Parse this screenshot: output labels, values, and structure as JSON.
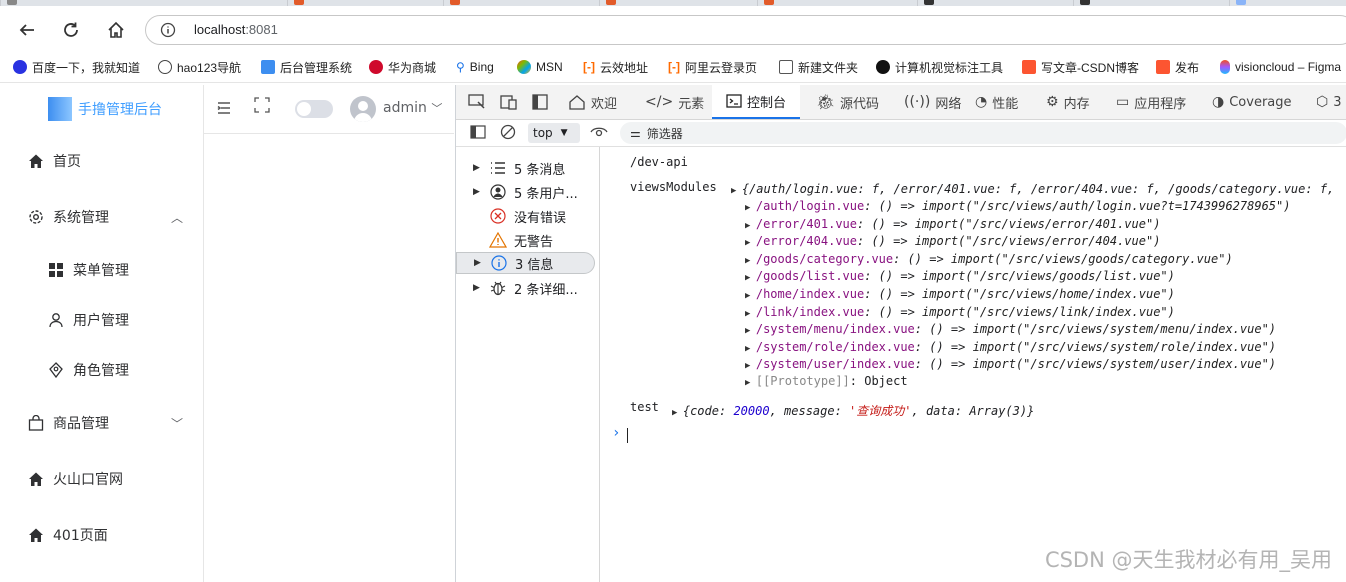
{
  "browser": {
    "url_host": "localhost",
    "url_port": ":8081",
    "bookmarks": [
      {
        "label": "百度一下，我就知道",
        "color": "#2932e1"
      },
      {
        "label": "hao123导航",
        "color": "#444444"
      },
      {
        "label": "后台管理系统",
        "color": "#3d8ef0"
      },
      {
        "label": "华为商城",
        "color": "#cf0a2c"
      },
      {
        "label": "Bing",
        "color": "#1a73e8"
      },
      {
        "label": "MSN",
        "color": "#6b5fd6"
      },
      {
        "label": "云效地址",
        "color": "#ff6a00"
      },
      {
        "label": "阿里云登录页",
        "color": "#ff6a00"
      },
      {
        "label": "新建文件夹",
        "color": "#555555"
      },
      {
        "label": "计算机视觉标注工具",
        "color": "#111111"
      },
      {
        "label": "写文章-CSDN博客",
        "color": "#fc5531"
      },
      {
        "label": "发布",
        "color": "#fc5531"
      },
      {
        "label": "visioncloud – Figma",
        "color": "#a259ff"
      }
    ]
  },
  "app": {
    "logo_text": "手撸管理后台",
    "user": "admin",
    "menu": [
      {
        "label": "首页",
        "icon": "home-icon"
      },
      {
        "label": "系统管理",
        "icon": "gear-icon",
        "arrow": "up"
      },
      {
        "label": "菜单管理",
        "icon": "grid-icon",
        "sub": true
      },
      {
        "label": "用户管理",
        "icon": "user-icon",
        "sub": true
      },
      {
        "label": "角色管理",
        "icon": "role-icon",
        "sub": true
      },
      {
        "label": "商品管理",
        "icon": "bag-icon",
        "arrow": "down"
      },
      {
        "label": "火山口官网",
        "icon": "home-icon"
      },
      {
        "label": "401页面",
        "icon": "home-icon"
      }
    ]
  },
  "devtools": {
    "tabs": [
      "欢迎",
      "元素",
      "控制台",
      "源代码",
      "网络",
      "性能",
      "内存",
      "应用程序",
      "Coverage",
      "3"
    ],
    "active_tab": "控制台",
    "context": "top",
    "filter_placeholder": "筛选器",
    "sidebar": [
      {
        "label": "5 条消息",
        "icon": "list-icon"
      },
      {
        "label": "5 条用户...",
        "icon": "user-circle-icon"
      },
      {
        "label": "没有错误",
        "icon": "error-icon"
      },
      {
        "label": "无警告",
        "icon": "warning-icon"
      },
      {
        "label": "3 信息",
        "icon": "info-icon",
        "selected": true
      },
      {
        "label": "2 条详细...",
        "icon": "bug-icon"
      }
    ],
    "console": {
      "line1": "/dev-api",
      "views_label": "viewsModules",
      "views_summary": "{/auth/login.vue: f, /error/401.vue: f, /error/404.vue: f, /goods/category.vue: f,",
      "entries": [
        {
          "key": "/auth/login.vue",
          "value": "import(\"/src/views/auth/login.vue?t=1743996278965\")"
        },
        {
          "key": "/error/401.vue",
          "value": "import(\"/src/views/error/401.vue\")"
        },
        {
          "key": "/error/404.vue",
          "value": "import(\"/src/views/error/404.vue\")"
        },
        {
          "key": "/goods/category.vue",
          "value": "import(\"/src/views/goods/category.vue\")"
        },
        {
          "key": "/goods/list.vue",
          "value": "import(\"/src/views/goods/list.vue\")"
        },
        {
          "key": "/home/index.vue",
          "value": "import(\"/src/views/home/index.vue\")"
        },
        {
          "key": "/link/index.vue",
          "value": "import(\"/src/views/link/index.vue\")"
        },
        {
          "key": "/system/menu/index.vue",
          "value": "import(\"/src/views/system/menu/index.vue\")"
        },
        {
          "key": "/system/role/index.vue",
          "value": "import(\"/src/views/system/role/index.vue\")"
        },
        {
          "key": "/system/user/index.vue",
          "value": "import(\"/src/views/system/user/index.vue\")"
        }
      ],
      "prototype_key": "[[Prototype]]",
      "prototype_value": "Object",
      "test_label": "test",
      "test_code_key": "code",
      "test_code": "20000",
      "test_message_key": "message",
      "test_message": "'查询成功'",
      "test_data_key": "data",
      "test_data": "Array(3)"
    }
  },
  "watermark": "CSDN @天生我材必有用_吴用"
}
